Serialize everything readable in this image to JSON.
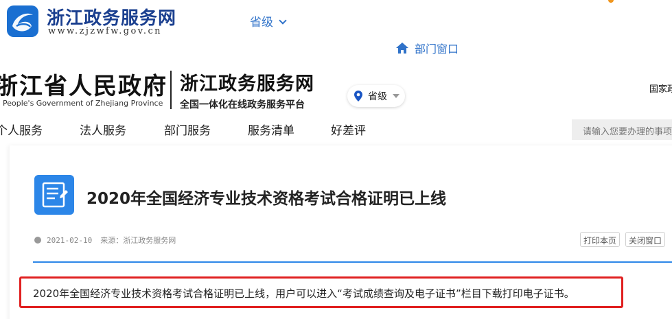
{
  "brand": {
    "title": "浙江政务服务网",
    "url": "www.zjzwfw.gov.cn",
    "logo_icon": "zj-logo-icon"
  },
  "top": {
    "region": "省级",
    "dept_window": "部门窗口"
  },
  "gov_header": {
    "gov_name": "浙江省人民政府",
    "gov_name_en": "People's Government of Zhejiang Province",
    "site_name": "浙江政务服务网",
    "site_subtitle": "全国一体化在线政务服务平台",
    "region_select": "省级",
    "national_link": "国家政"
  },
  "nav": {
    "items": [
      "个人服务",
      "法人服务",
      "部门服务",
      "服务清单",
      "好差评"
    ],
    "search_placeholder": "请输入您要办理的事项"
  },
  "article": {
    "title": "2020年全国经济专业技术资格考试合格证明已上线",
    "date": "2021-02-10",
    "source": "来源：浙江政务服务网",
    "print_label": "打印本页",
    "close_label": "关闭窗口",
    "body": "2020年全国经济专业技术资格考试合格证明已上线，用户可以进入“考试成绩查询及电子证书”栏目下载打印电子证书。"
  },
  "colors": {
    "brand_blue": "#1a6fd1",
    "link_blue": "#2f72c9",
    "accent_blue": "#2c86e8",
    "highlight_red": "#e02020"
  }
}
